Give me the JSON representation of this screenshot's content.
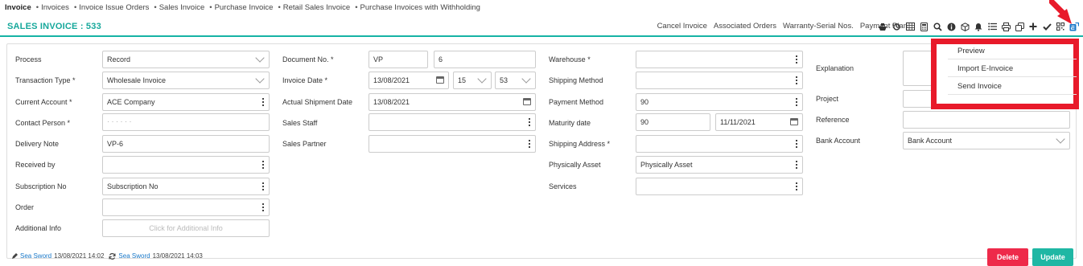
{
  "breadcrumbs": [
    "Invoice",
    "Invoices",
    "Invoice Issue Orders",
    "Sales Invoice",
    "Purchase Invoice",
    "Retail Sales Invoice",
    "Purchase Invoices with Withholding"
  ],
  "breadcrumb_separator": "•",
  "header": {
    "title": "SALES INVOICE : 533",
    "actions": [
      "Cancel Invoice",
      "Associated Orders",
      "Warranty-Serial Nos.",
      "Payment Plan"
    ],
    "icons": [
      "ship-icon",
      "history-icon",
      "table-icon",
      "calculator-icon",
      "search-icon",
      "info-icon",
      "cube-icon",
      "bell-icon",
      "list-icon",
      "print-icon",
      "copy-icon",
      "plus-icon",
      "check-icon",
      "qr-icon",
      "e-invoice-icon"
    ]
  },
  "form": {
    "process": {
      "label": "Process",
      "value": "Record"
    },
    "transaction_type": {
      "label": "Transaction Type *",
      "value": "Wholesale Invoice"
    },
    "current_account": {
      "label": "Current Account *",
      "value": "ACE Company"
    },
    "contact_person": {
      "label": "Contact Person *",
      "value": "· · · · · ·"
    },
    "delivery_note": {
      "label": "Delivery Note",
      "value": "VP-6"
    },
    "received_by": {
      "label": "Received by",
      "value": ""
    },
    "subscription_no": {
      "label": "Subscription No",
      "value": "Subscription No"
    },
    "order": {
      "label": "Order",
      "value": ""
    },
    "additional_info": {
      "label": "Additional Info",
      "placeholder": "Click for Additional Info"
    },
    "document_no": {
      "label": "Document No. *",
      "prefix": "VP",
      "number": "6"
    },
    "invoice_date": {
      "label": "Invoice Date *",
      "date": "13/08/2021",
      "hour": "15",
      "minute": "53"
    },
    "actual_shipment_date": {
      "label": "Actual Shipment Date",
      "value": "13/08/2021"
    },
    "sales_staff": {
      "label": "Sales Staff",
      "value": ""
    },
    "sales_partner": {
      "label": "Sales Partner",
      "value": ""
    },
    "warehouse": {
      "label": "Warehouse *",
      "value": ""
    },
    "shipping_method": {
      "label": "Shipping Method",
      "value": ""
    },
    "payment_method": {
      "label": "Payment Method",
      "value": "90"
    },
    "maturity_date": {
      "label": "Maturity date",
      "days": "90",
      "date": "11/11/2021"
    },
    "shipping_address": {
      "label": "Shipping Address *",
      "value": ""
    },
    "physically_asset": {
      "label": "Physically Asset",
      "value": "Physically Asset"
    },
    "services": {
      "label": "Services",
      "value": ""
    },
    "explanation": {
      "label": "Explanation",
      "value": ""
    },
    "project": {
      "label": "Project",
      "value": ""
    },
    "reference": {
      "label": "Reference",
      "value": ""
    },
    "bank_account": {
      "label": "Bank Account",
      "value": "Bank Account"
    }
  },
  "footer": {
    "created_by": "Sea Sword",
    "created_at": "13/08/2021 14:02",
    "updated_by": "Sea Sword",
    "updated_at": "13/08/2021 14:03",
    "delete_label": "Delete",
    "update_label": "Update"
  },
  "dropdown_menu": {
    "items": [
      "Preview",
      "Import E-Invoice",
      "Send Invoice"
    ]
  },
  "colors": {
    "accent": "#16a89b",
    "delete": "#ee2a4a",
    "update": "#1fb7a4",
    "highlight": "#e81a2a",
    "link": "#1a79c9"
  }
}
